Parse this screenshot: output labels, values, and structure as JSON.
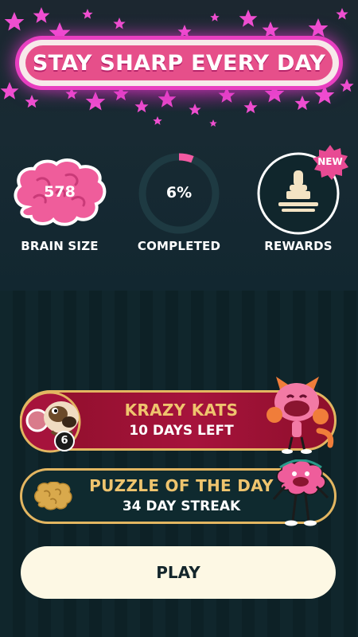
{
  "banner": {
    "title": "STAY SHARP EVERY DAY"
  },
  "stats": {
    "brain": {
      "value": "578",
      "label": "BRAIN SIZE",
      "icon": "brain-icon"
    },
    "completed": {
      "value": "6%",
      "label": "COMPLETED",
      "progress": 0.06
    },
    "rewards": {
      "label": "REWARDS",
      "badge": "NEW",
      "icon": "stamp-icon"
    }
  },
  "cards": {
    "event": {
      "title": "KRAZY KATS",
      "subtitle": "10 DAYS LEFT",
      "level": "6"
    },
    "puzzle": {
      "title": "PUZZLE OF THE DAY",
      "subtitle": "34 DAY STREAK"
    }
  },
  "play": {
    "label": "PLAY"
  },
  "colors": {
    "accent_pink": "#e64f8a",
    "star_pink": "#e83fc0",
    "gold": "#e3b661",
    "event_red": "#a6133c",
    "cream": "#fdf8e4"
  }
}
